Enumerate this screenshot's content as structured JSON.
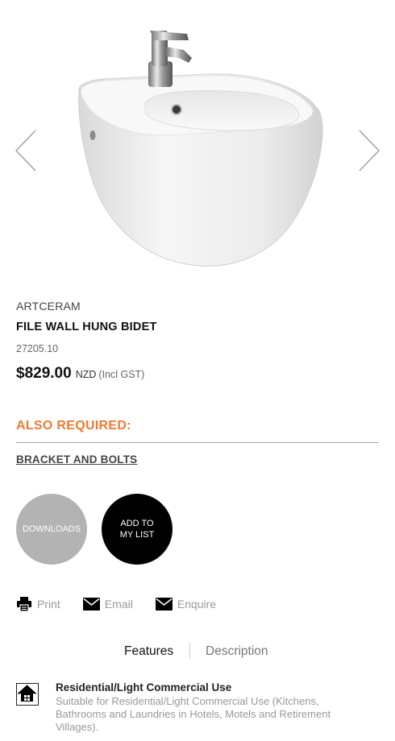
{
  "product": {
    "brand": "ARTCERAM",
    "name": "FILE WALL HUNG BIDET",
    "sku": "27205.10",
    "price": "$829.00",
    "currency": "NZD",
    "gst_note": "(Incl GST)"
  },
  "also_required": {
    "heading": "ALSO REQUIRED:",
    "items": [
      "BRACKET AND BOLTS"
    ],
    "heading_color": "#ee7a33"
  },
  "buttons": {
    "downloads": "DOWNLOADS",
    "add_to_list": "ADD TO\nMY LIST"
  },
  "actions": [
    {
      "label": "Print",
      "icon": "printer-icon"
    },
    {
      "label": "Email",
      "icon": "envelope-icon"
    },
    {
      "label": "Enquire",
      "icon": "envelope-icon"
    }
  ],
  "tabs": [
    {
      "label": "Features",
      "active": true
    },
    {
      "label": "Description",
      "active": false
    }
  ],
  "features": [
    {
      "icon": "house-icon",
      "title": "Residential/Light Commercial Use",
      "description": "Suitable for Residential/Light Commercial Use (Kitchens, Bathrooms and Laundries in Hotels, Motels and Retirement Villages)."
    }
  ],
  "gallery": {
    "prev_icon": "chevron-left-icon",
    "next_icon": "chevron-right-icon"
  }
}
